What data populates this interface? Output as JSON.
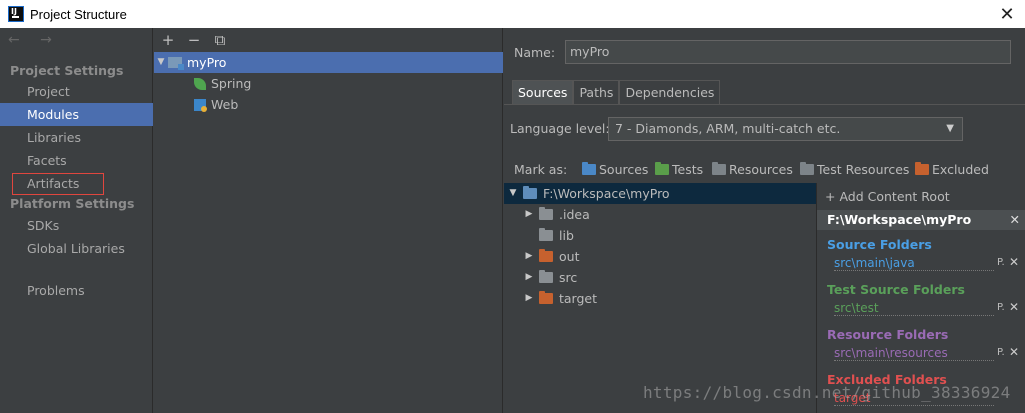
{
  "window": {
    "title": "Project Structure"
  },
  "sidebar": {
    "nav": "← →",
    "project_settings": "Project Settings",
    "project_items": [
      "Project",
      "Modules",
      "Libraries",
      "Facets",
      "Artifacts"
    ],
    "platform_settings": "Platform Settings",
    "platform_items": [
      "SDKs",
      "Global Libraries"
    ],
    "problems": "Problems"
  },
  "module_tree": {
    "toolbar": {
      "add": "+",
      "remove": "−",
      "copy": "⧉"
    },
    "root": "myPro",
    "children": [
      "Spring",
      "Web"
    ]
  },
  "details": {
    "name_label": "Name:",
    "name_value": "myPro",
    "tabs": [
      "Sources",
      "Paths",
      "Dependencies"
    ],
    "language_label": "Language level:",
    "language_value": "7 - Diamonds, ARM, multi-catch etc.",
    "mark_as_label": "Mark as:",
    "mark_as": [
      {
        "label": "Sources",
        "color": "#4a88c7"
      },
      {
        "label": "Tests",
        "color": "#5a9e4a"
      },
      {
        "label": "Resources",
        "color": "#7d8489"
      },
      {
        "label": "Test Resources",
        "color": "#7d8489"
      },
      {
        "label": "Excluded",
        "color": "#c6612e"
      }
    ]
  },
  "content_tree": {
    "root": "F:\\Workspace\\myPro",
    "children": [
      ".idea",
      "lib",
      "out",
      "src",
      "target"
    ]
  },
  "content_root": {
    "add_label": "+ Add Content Root",
    "path": "F:\\Workspace\\myPro",
    "sections": [
      {
        "title": "Source Folders",
        "path": "src\\main\\java",
        "title_color": "#4a9fe5",
        "path_color": "#4a9fe5"
      },
      {
        "title": "Test Source Folders",
        "path": "src\\test",
        "title_color": "#5aa05a",
        "path_color": "#5aa05a"
      },
      {
        "title": "Resource Folders",
        "path": "src\\main\\resources",
        "title_color": "#9a6bb5",
        "path_color": "#9a6bb5"
      },
      {
        "title": "Excluded Folders",
        "path": "target",
        "title_color": "#e05050",
        "path_color": "#e05050"
      }
    ]
  },
  "watermark": "https://blog.csdn.net/github_38336924"
}
